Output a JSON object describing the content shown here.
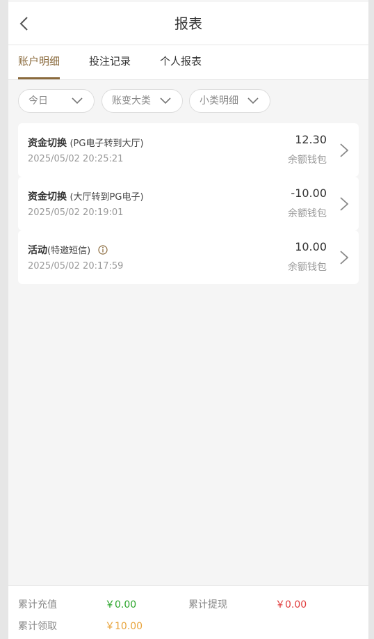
{
  "header": {
    "title": "报表"
  },
  "tabs": [
    {
      "label": "账户明细"
    },
    {
      "label": "投注记录"
    },
    {
      "label": "个人报表"
    }
  ],
  "filters": [
    {
      "label": "今日"
    },
    {
      "label": "账变大类"
    },
    {
      "label": "小类明细"
    }
  ],
  "records": [
    {
      "title": "资金切换",
      "detail": "(PG电子转到大厅)",
      "datetime": "2025/05/02 20:25:21",
      "amount": "12.30",
      "wallet": "余额钱包"
    },
    {
      "title": "资金切换",
      "detail": "(大厅转到PG电子)",
      "datetime": "2025/05/02 20:19:01",
      "amount": "-10.00",
      "wallet": "余额钱包"
    },
    {
      "title": "活动",
      "detail": "(特邀短信)",
      "datetime": "2025/05/02 20:17:59",
      "amount": "10.00",
      "wallet": "余额钱包"
    }
  ],
  "summary": {
    "recharge_label": "累计充值",
    "recharge_value": "￥0.00",
    "withdraw_label": "累计提现",
    "withdraw_value": "￥0.00",
    "claim_label": "累计领取",
    "claim_value": "￥10.00"
  },
  "colors": {
    "accent": "#8a6a3c",
    "green": "#2aa52a",
    "red": "#e03c3c",
    "orange": "#e8a33a"
  }
}
